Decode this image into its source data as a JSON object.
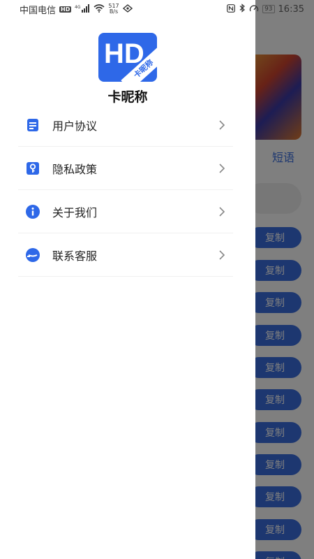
{
  "status_bar": {
    "carrier": "中国电信",
    "signal": "4G",
    "net_speed_value": "517",
    "net_speed_unit": "B/s",
    "battery": "93",
    "time": "16:35"
  },
  "drawer": {
    "app_name": "卡昵称",
    "logo_text": "HD",
    "logo_ribbon": "卡昵称",
    "menu": [
      {
        "label": "用户协议",
        "icon": "document-icon"
      },
      {
        "label": "隐私政策",
        "icon": "key-icon"
      },
      {
        "label": "关于我们",
        "icon": "info-icon"
      },
      {
        "label": "联系客服",
        "icon": "customer-service-icon"
      }
    ]
  },
  "background": {
    "tab_label": "短语",
    "copy_label": "复制"
  },
  "colors": {
    "accent": "#2e68e8",
    "overlay": "rgba(0,0,0,0.5)"
  }
}
